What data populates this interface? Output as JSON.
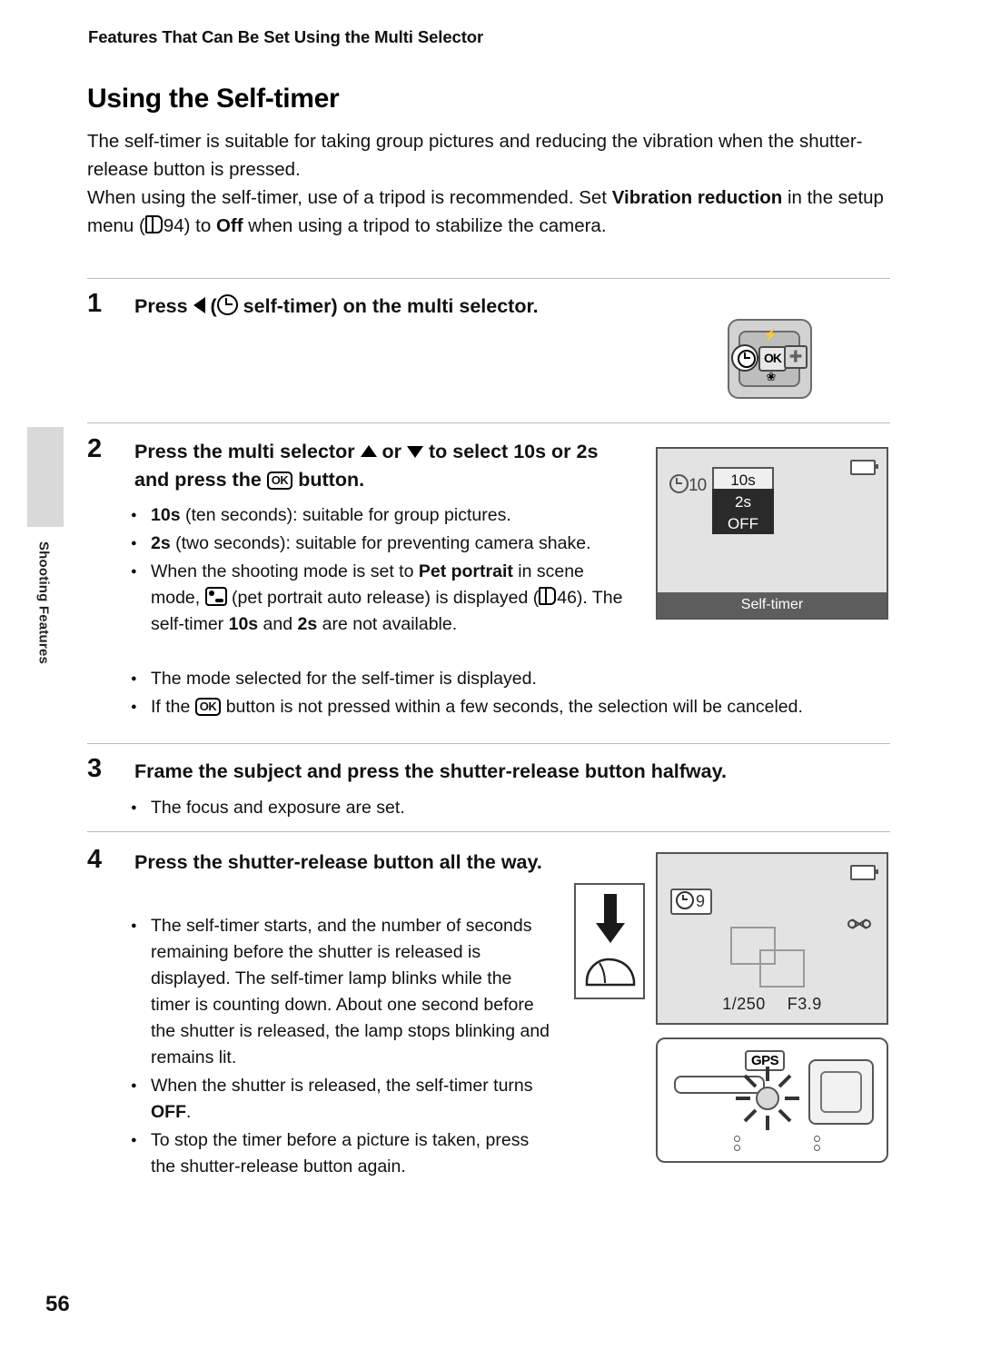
{
  "header": {
    "running_head": "Features That Can Be Set Using the Multi Selector"
  },
  "side_tab": {
    "label": "Shooting Features"
  },
  "title": "Using the Self-timer",
  "intro": {
    "para1": "The self-timer is suitable for taking group pictures and reducing the vibration when the shutter-release button is pressed.",
    "para2_a": "When using the self-timer, use of a tripod is recommended. Set ",
    "para2_bold1": "Vibration reduction",
    "para2_b": " in the setup menu (",
    "para2_ref": "94) to ",
    "para2_bold2": "Off",
    "para2_c": " when using a tripod to stabilize the camera."
  },
  "steps": [
    {
      "number": "1",
      "heading_a": "Press ",
      "heading_b": " (",
      "heading_c": " self-timer) on the multi selector."
    },
    {
      "number": "2",
      "heading_a": "Press the multi selector ",
      "heading_b": " or ",
      "heading_c": " to select ",
      "heading_bold1": "10s",
      "heading_d": " or ",
      "heading_bold2": "2s",
      "heading_e": " and press the ",
      "heading_f": " button.",
      "bullets": [
        {
          "bold": "10s",
          "rest": " (ten seconds): suitable for group pictures."
        },
        {
          "bold": "2s",
          "rest": " (two seconds): suitable for preventing camera shake."
        },
        {
          "text_a": "When the shooting mode is set to ",
          "bold": "Pet portrait",
          "text_b": " in scene mode, ",
          "text_c": " (pet portrait auto release) is displayed (",
          "ref": "46). The self-timer ",
          "bold2": "10s",
          "text_d": " and ",
          "bold3": "2s",
          "text_e": " are not available."
        },
        {
          "text": "The mode selected for the self-timer is displayed."
        },
        {
          "text_a": "If the ",
          "text_b": " button is not pressed within a few seconds, the selection will be canceled."
        }
      ]
    },
    {
      "number": "3",
      "heading": "Frame the subject and press the shutter-release button halfway.",
      "bullets": [
        {
          "text": "The focus and exposure are set."
        }
      ]
    },
    {
      "number": "4",
      "heading": "Press the shutter-release button all the way.",
      "bullets": [
        {
          "text": "The self-timer starts, and the number of seconds remaining before the shutter is released is displayed. The self-timer lamp blinks while the timer is counting down. About one second before the shutter is released, the lamp stops blinking and remains lit."
        },
        {
          "text_a": "When the shutter is released, the self-timer turns ",
          "bold": "OFF",
          "text_b": "."
        },
        {
          "text": "To stop the timer before a picture is taken, press the shutter-release button again."
        }
      ]
    }
  ],
  "multi_selector": {
    "up_label": "⚡",
    "down_label": "❀",
    "ok_label": "OK",
    "right_label": "➕"
  },
  "monitor1": {
    "indicator": "10",
    "menu": [
      "10s",
      "2s",
      "OFF"
    ],
    "selected": "OFF",
    "caption": "Self-timer"
  },
  "monitor2": {
    "timer_value": "9",
    "shutter_speed": "1/250",
    "aperture": "F3.9"
  },
  "camera_front": {
    "gps_label": "GPS"
  },
  "folio": "56"
}
